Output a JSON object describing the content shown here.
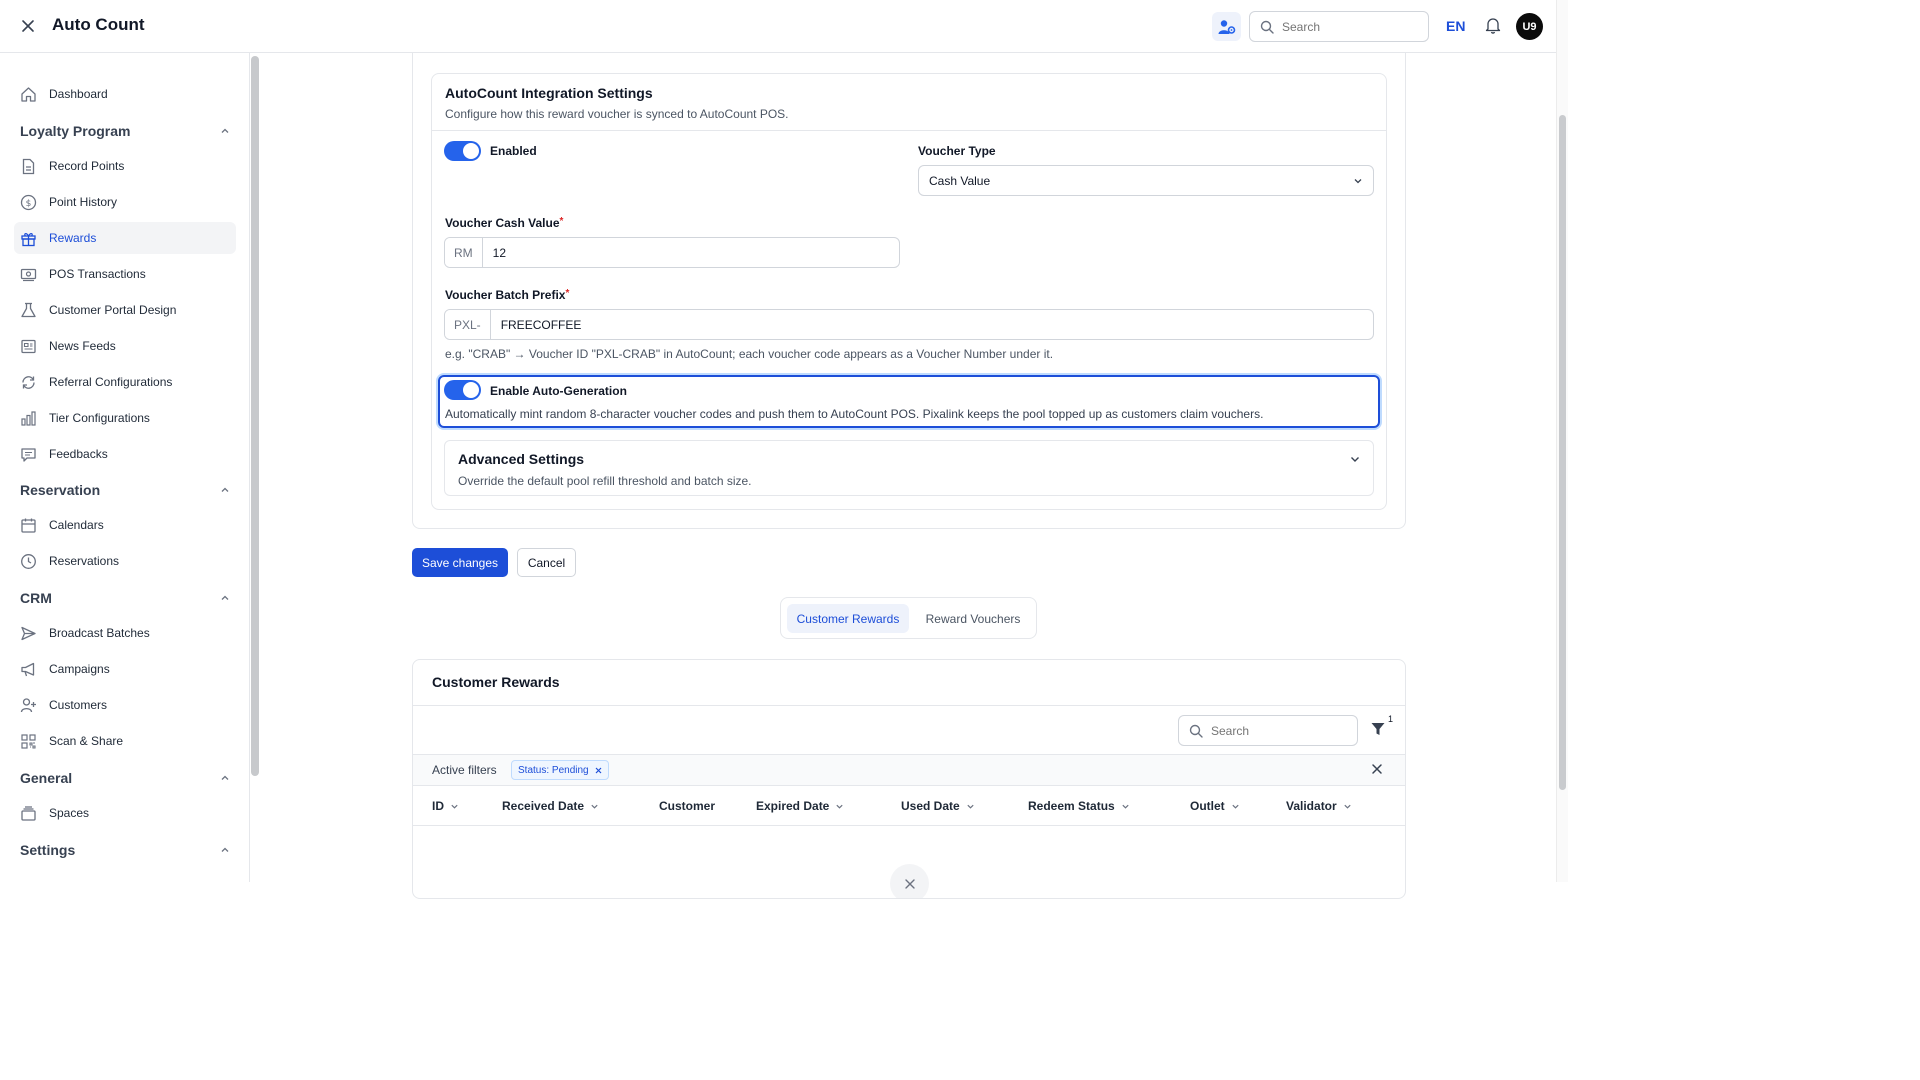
{
  "header": {
    "title": "Auto Count",
    "search_placeholder": "Search",
    "language": "EN",
    "avatar_initials": "U9"
  },
  "sidebar": {
    "dashboard": "Dashboard",
    "sections": [
      {
        "title": "Loyalty Program",
        "items": [
          "Record Points",
          "Point History",
          "Rewards",
          "POS Transactions",
          "Customer Portal Design",
          "News Feeds",
          "Referral Configurations",
          "Tier Configurations",
          "Feedbacks"
        ]
      },
      {
        "title": "Reservation",
        "items": [
          "Calendars",
          "Reservations"
        ]
      },
      {
        "title": "CRM",
        "items": [
          "Broadcast Batches",
          "Campaigns",
          "Customers",
          "Scan & Share"
        ]
      },
      {
        "title": "General",
        "items": [
          "Spaces"
        ]
      },
      {
        "title": "Settings",
        "items": []
      }
    ],
    "active_item": "Rewards"
  },
  "integration": {
    "title": "AutoCount Integration Settings",
    "description": "Configure how this reward voucher is synced to AutoCount POS.",
    "enabled_label": "Enabled",
    "enabled": true,
    "voucher_type_label": "Voucher Type",
    "voucher_type_value": "Cash Value",
    "cash_value_label": "Voucher Cash Value",
    "cash_value_prefix": "RM",
    "cash_value": "12",
    "batch_prefix_label": "Voucher Batch Prefix",
    "batch_prefix_addon": "PXL-",
    "batch_prefix_value": "FREECOFFEE",
    "batch_prefix_hint": "e.g. \"CRAB\" → Voucher ID \"PXL-CRAB\" in AutoCount; each voucher code appears as a Voucher Number under it.",
    "autogen_label": "Enable Auto-Generation",
    "autogen_enabled": true,
    "autogen_description": "Automatically mint random 8-character voucher codes and push them to AutoCount POS. Pixalink keeps the pool topped up as customers claim vouchers.",
    "advanced_title": "Advanced Settings",
    "advanced_description": "Override the default pool refill threshold and batch size.",
    "required_mark": "*"
  },
  "actions": {
    "save": "Save changes",
    "cancel": "Cancel"
  },
  "tabs": [
    "Customer Rewards",
    "Reward Vouchers"
  ],
  "customer_rewards": {
    "title": "Customer Rewards",
    "search_placeholder": "Search",
    "filter_count": "1",
    "active_filters_label": "Active filters",
    "filter_chip": "Status: Pending",
    "columns": [
      "ID",
      "Received Date",
      "Customer",
      "Expired Date",
      "Used Date",
      "Redeem Status",
      "Outlet",
      "Validator"
    ]
  },
  "colors": {
    "accent": "#1d4ed8",
    "toggle_on": "#2563eb",
    "required": "#dc2626"
  }
}
